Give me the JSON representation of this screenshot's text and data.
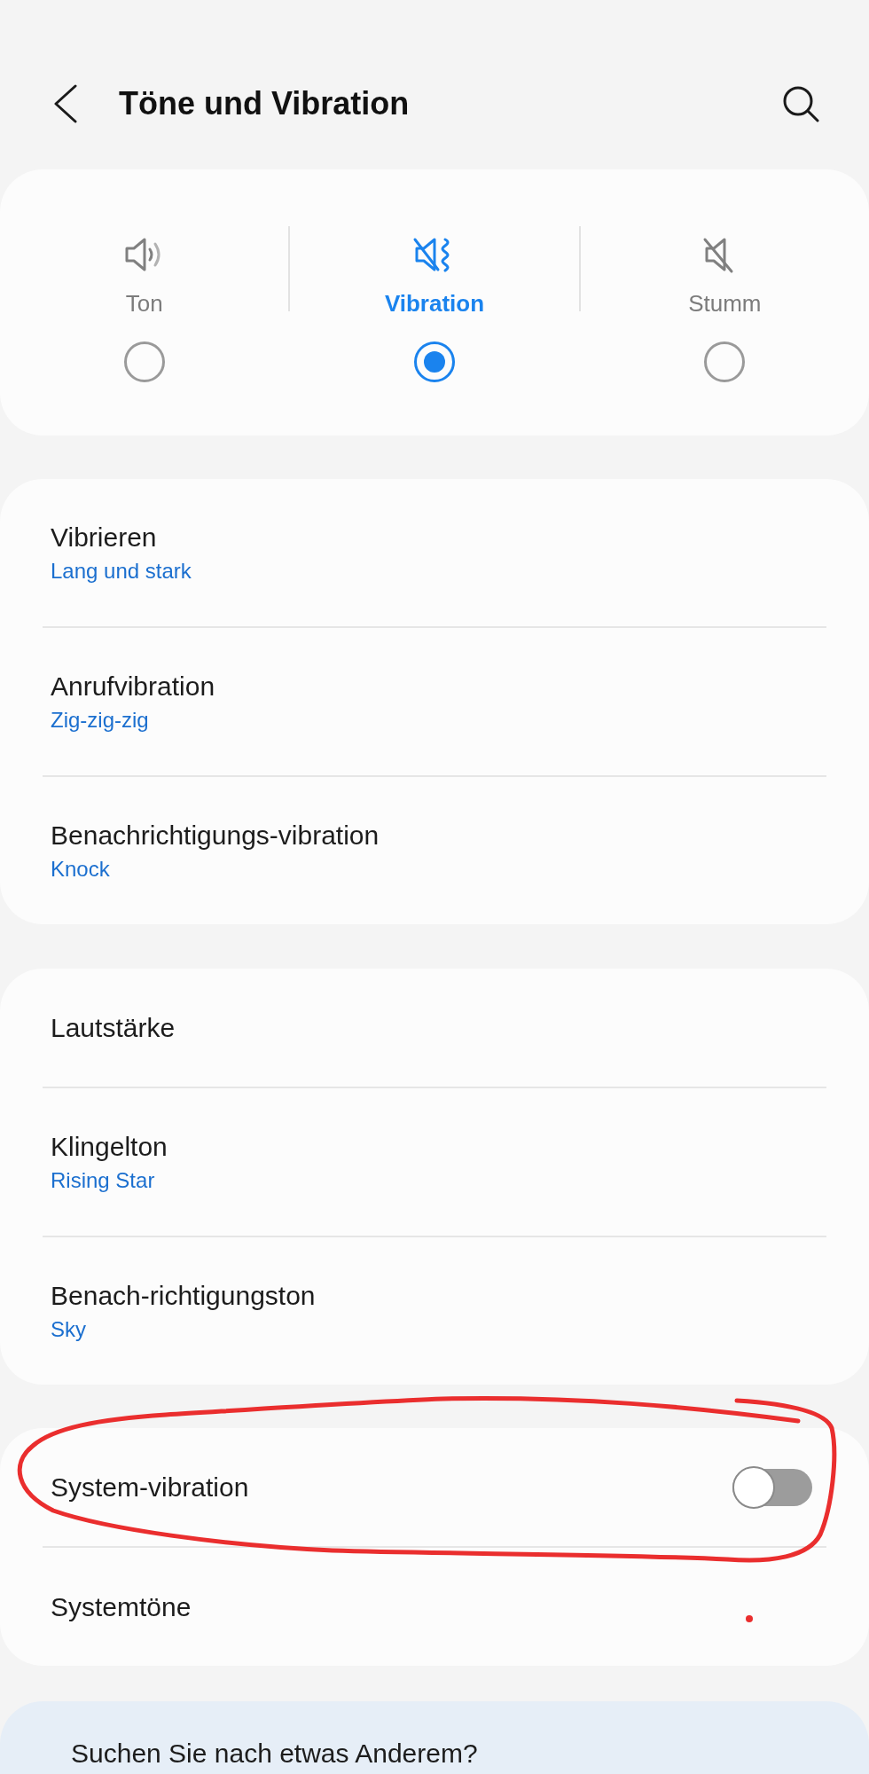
{
  "header": {
    "title": "Töne und Vibration"
  },
  "sound_modes": [
    {
      "kind": "sound",
      "label": "Ton",
      "selected": false
    },
    {
      "kind": "vibrate",
      "label": "Vibration",
      "selected": true
    },
    {
      "kind": "mute",
      "label": "Stumm",
      "selected": false
    }
  ],
  "groups": [
    {
      "items": [
        {
          "kind": "link",
          "title": "Vibrieren",
          "value": "Lang und stark"
        },
        {
          "kind": "link",
          "title": "Anrufvibration",
          "value": "Zig-zig-zig"
        },
        {
          "kind": "link",
          "title": "Benachrichtigungs-vibration",
          "value": "Knock"
        }
      ]
    },
    {
      "items": [
        {
          "kind": "link",
          "title": "Lautstärke"
        },
        {
          "kind": "link",
          "title": "Klingelton",
          "value": "Rising Star"
        },
        {
          "kind": "link",
          "title": "Benach-richtigungston",
          "value": "Sky"
        }
      ]
    },
    {
      "items": [
        {
          "kind": "toggle",
          "title": "System-vibration",
          "on": false
        },
        {
          "kind": "link",
          "title": "Systemtöne"
        }
      ]
    }
  ],
  "suggestion_card": {
    "title": "Suchen Sie nach etwas Anderem?"
  }
}
